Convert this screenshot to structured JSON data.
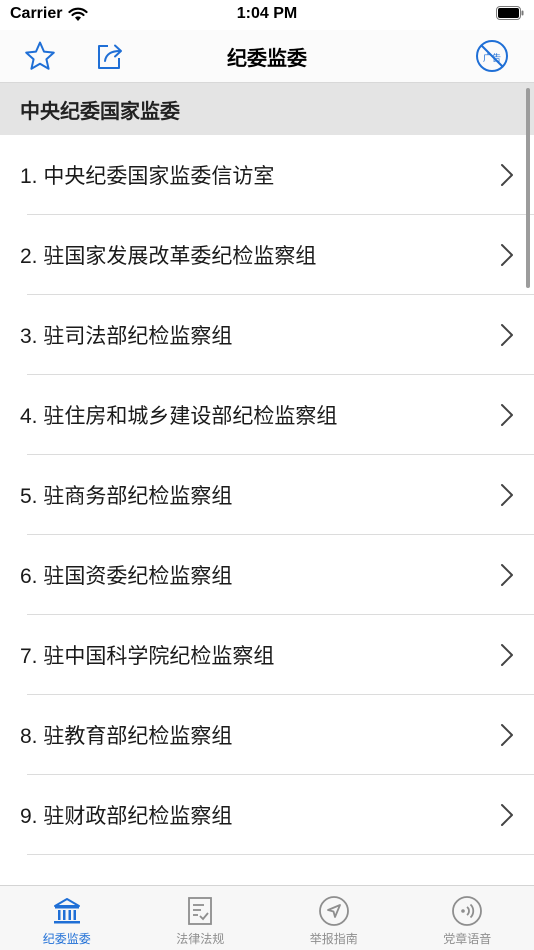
{
  "status_bar": {
    "carrier": "Carrier",
    "time": "1:04 PM"
  },
  "nav": {
    "title": "纪委监委",
    "left_icons": [
      "star-icon",
      "share-icon"
    ],
    "right_icon": "no-ads-icon",
    "right_icon_text": "广告",
    "accent_color": "#1f6fd6"
  },
  "section": {
    "title": "中央纪委国家监委"
  },
  "list_items": [
    "1. 中央纪委国家监委信访室",
    "2. 驻国家发展改革委纪检监察组",
    "3. 驻司法部纪检监察组",
    "4. 驻住房和城乡建设部纪检监察组",
    "5. 驻商务部纪检监察组",
    "6. 驻国资委纪检监察组",
    "7. 驻中国科学院纪检监察组",
    "8. 驻教育部纪检监察组",
    "9. 驻财政部纪检监察组"
  ],
  "tabs": [
    {
      "label": "纪委监委",
      "icon": "institution-icon",
      "active": true
    },
    {
      "label": "法律法规",
      "icon": "checklist-icon",
      "active": false
    },
    {
      "label": "举报指南",
      "icon": "navigation-icon",
      "active": false
    },
    {
      "label": "党章语音",
      "icon": "audio-icon",
      "active": false
    }
  ]
}
